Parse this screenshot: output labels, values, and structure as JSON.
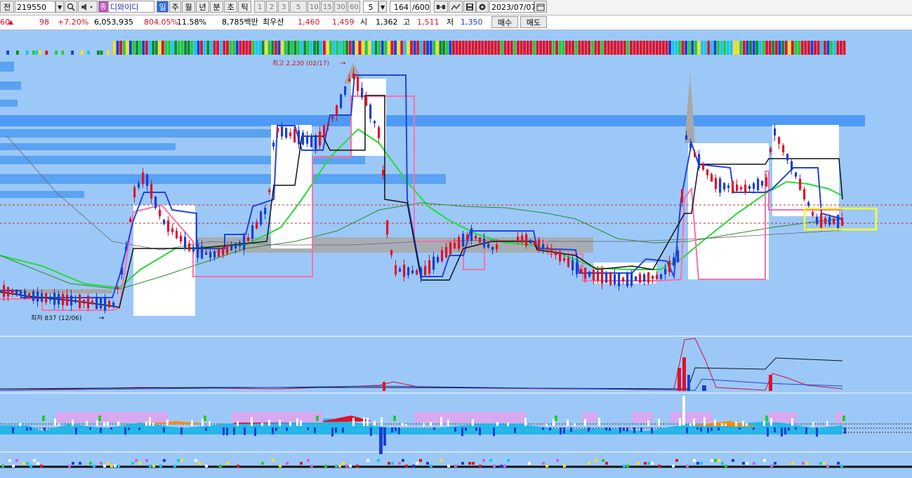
{
  "toolbar": {
    "period_label": "전",
    "stock_code": "219550",
    "stock_name": "디와이디",
    "stock_prefix": "종",
    "periods": [
      "일",
      "주",
      "월",
      "년",
      "분",
      "초",
      "틱"
    ],
    "intervals": [
      "1",
      "2",
      "3",
      "5",
      "10",
      "15",
      "30",
      "60"
    ],
    "interval_value": "5",
    "count_value": "164",
    "count_total": "/600",
    "date": "2023/07/07"
  },
  "quote": {
    "price_fragment": "60",
    "change": "98",
    "change_pct": "+7.20%",
    "volume": "6,053,935",
    "volume_ratio": "804.05%",
    "turnover": "11.58%",
    "amount": "8,785백만",
    "best_label": "최우선",
    "best_ask": "1,460",
    "best_bid": "1,459",
    "open_label": "시",
    "open": "1,362",
    "high_label": "고",
    "high": "1,511",
    "low_label": "저",
    "low": "1,350",
    "buy_label": "매수",
    "sell_label": "매도"
  },
  "annotations": {
    "high_marker": "최고 2,230 (02/17)",
    "low_marker": "최저 837 (12/06)"
  },
  "colors": {
    "background": "#9cc8f8",
    "up": "#e0102a",
    "down": "#1a3fd0",
    "ma_green": "#22dd33",
    "band_pink": "#ff6fa8",
    "highlight": "#ffff20"
  },
  "icons": [
    "dropdown-arrow-icon",
    "search-icon",
    "speaker-icon",
    "link-icon",
    "magnify-icon",
    "save-icon",
    "settings-icon"
  ]
}
